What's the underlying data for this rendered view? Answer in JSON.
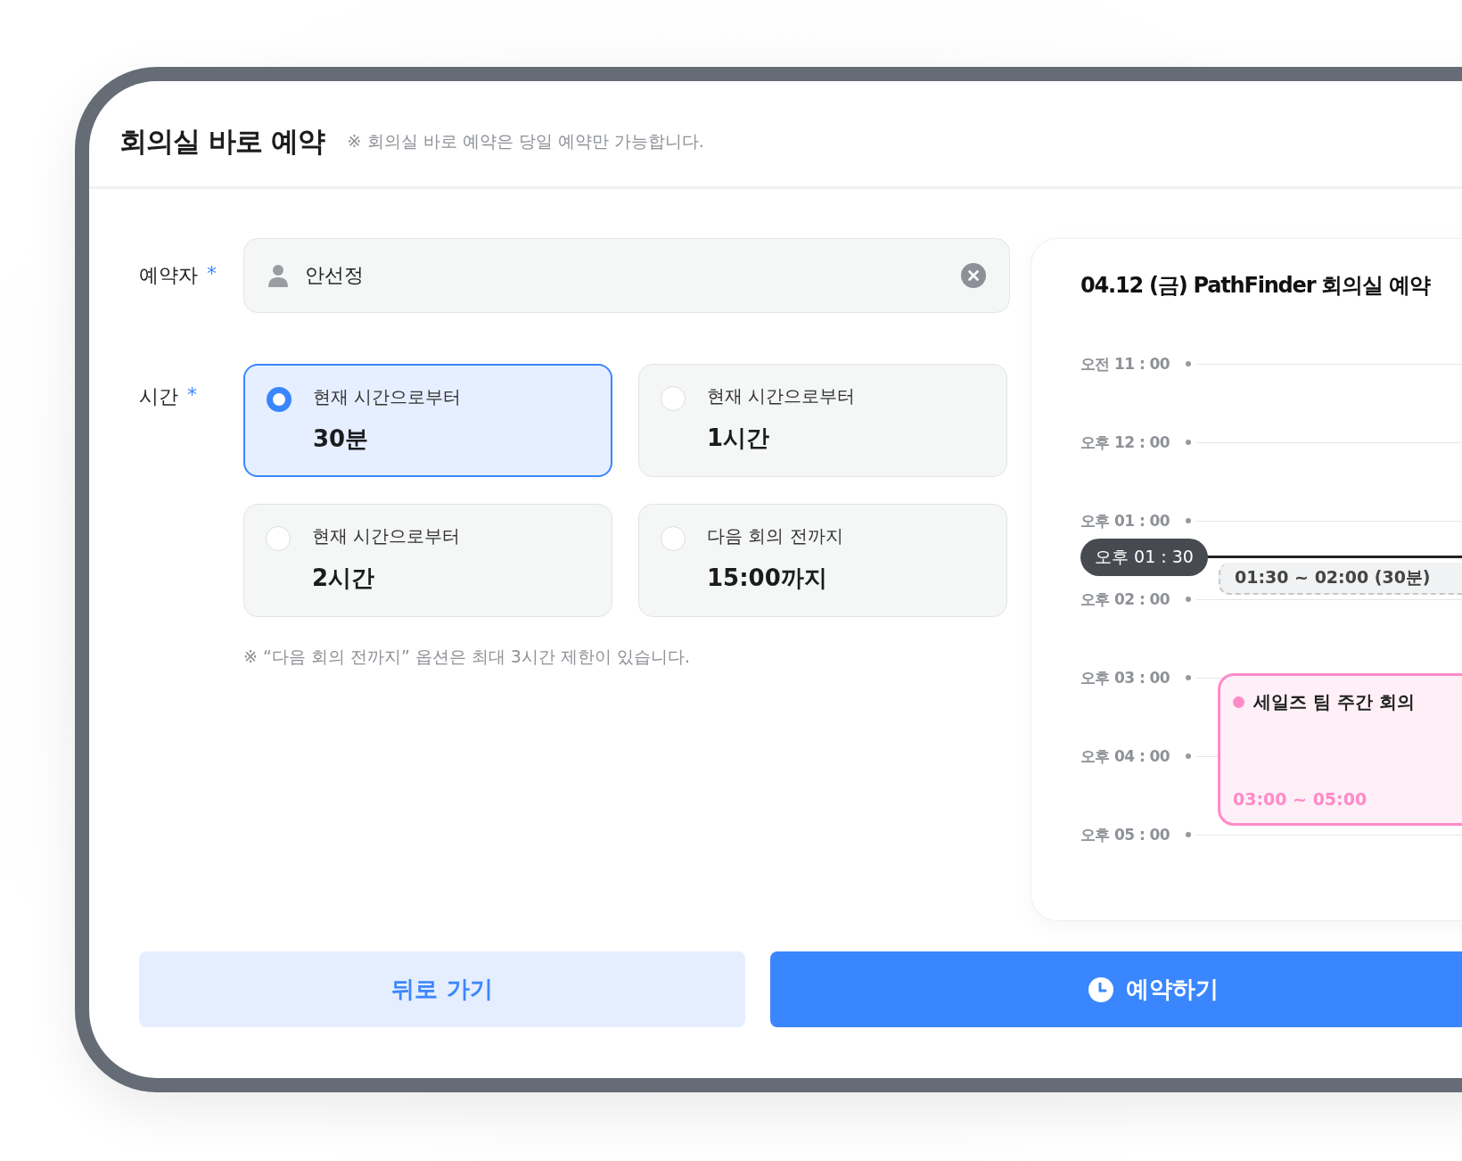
{
  "header": {
    "title": "회의실 바로 예약",
    "notice": "※ 회의실 바로 예약은 당일 예약만 가능합니다."
  },
  "booker": {
    "label": "예약자",
    "required_mark": "*",
    "value": "안선정"
  },
  "time": {
    "label": "시간",
    "required_mark": "*",
    "options": [
      {
        "caption": "현재 시간으로부터",
        "value": "30분",
        "selected": true
      },
      {
        "caption": "현재 시간으로부터",
        "value": "1시간",
        "selected": false
      },
      {
        "caption": "현재 시간으로부터",
        "value": "2시간",
        "selected": false
      },
      {
        "caption": "다음 회의 전까지",
        "value": "15:00까지",
        "selected": false
      }
    ],
    "note": "※ “다음 회의 전까지” 옵션은 최대 3시간 제한이 있습니다."
  },
  "schedule": {
    "title": "04.12 (금) PathFinder 회의실 예약",
    "hours": [
      "오전 11 : 00",
      "오후 12 : 00",
      "오후 01 : 00",
      "오후 02 : 00",
      "오후 03 : 00",
      "오후 04 : 00",
      "오후 05 : 00"
    ],
    "current_time": "오후 01 : 30",
    "pending_slot": "01:30 ~ 02:00 (30분)",
    "events": [
      {
        "title": "세일즈 팀 주간 회의",
        "time": "03:00 ~ 05:00",
        "color": "#ff8ac8"
      }
    ]
  },
  "buttons": {
    "back": "뒤로 가기",
    "submit": "예약하기"
  }
}
